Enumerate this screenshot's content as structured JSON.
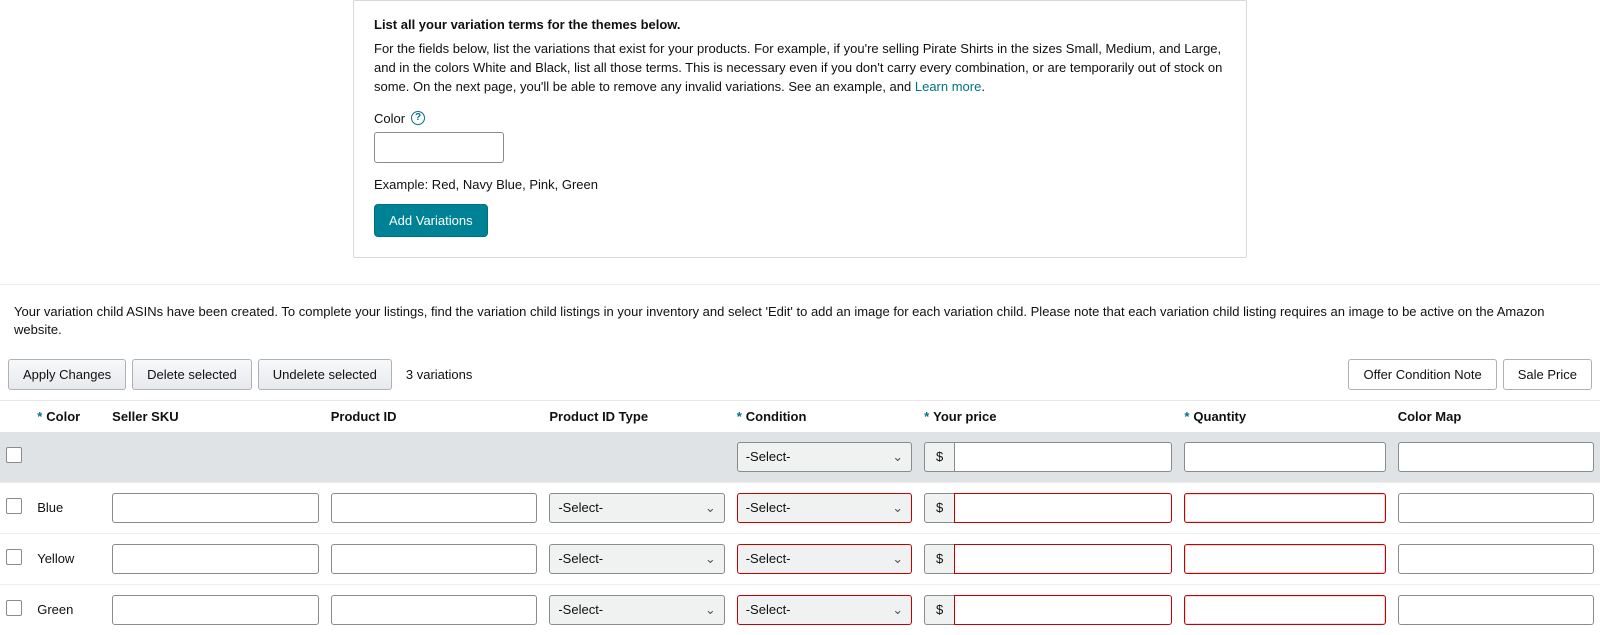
{
  "panel": {
    "title": "List all your variation terms for the themes below.",
    "desc_a": "For the fields below, list the variations that exist for your products. For example, if you're selling Pirate Shirts in the sizes Small, Medium, and Large, and in the colors White and Black, list all those terms. This is necessary even if you don't carry every combination, or are temporarily out of stock on some. On the next page, you'll be able to remove any invalid variations. See an example, and ",
    "learn_more": "Learn more",
    "desc_end": ".",
    "color_label": "Color",
    "example": "Example: Red, Navy Blue, Pink, Green",
    "add_btn": "Add Variations"
  },
  "info_bar": "Your variation child ASINs have been created. To complete your listings, find the variation child listings in your inventory and select 'Edit' to add an image for each variation child. Please note that each variation child listing requires an image to be active on the Amazon website.",
  "toolbar": {
    "apply": "Apply Changes",
    "delete": "Delete selected",
    "undelete": "Undelete selected",
    "count": "3 variations",
    "offer_note": "Offer Condition Note",
    "sale_price": "Sale Price"
  },
  "headers": {
    "color": "Color",
    "sku": "Seller SKU",
    "product_id": "Product ID",
    "product_id_type": "Product ID Type",
    "condition": "Condition",
    "your_price": "Your price",
    "quantity": "Quantity",
    "color_map": "Color Map"
  },
  "select_placeholder": "-Select-",
  "currency": "$",
  "rows": [
    {
      "color": "Blue"
    },
    {
      "color": "Yellow"
    },
    {
      "color": "Green"
    }
  ]
}
